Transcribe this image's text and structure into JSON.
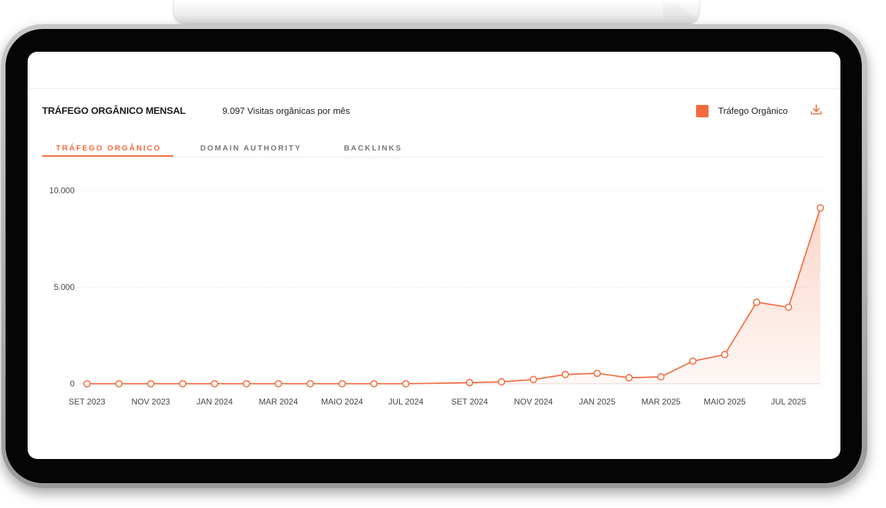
{
  "header": {
    "title": "TRÁFEGO ORGÂNICO MENSAL",
    "subtitle": "9.097 Visitas orgânicas por mês",
    "legend_label": "Tráfego Orgânico",
    "download_icon": "download-icon"
  },
  "tabs": [
    {
      "label": "TRÁFEGO ORGÂNICO",
      "active": true
    },
    {
      "label": "DOMAIN AUTHORITY",
      "active": false
    },
    {
      "label": "BACKLINKS",
      "active": false
    }
  ],
  "colors": {
    "accent": "#f26a3d",
    "grid": "#e6e6e6"
  },
  "chart_data": {
    "type": "area",
    "series": [
      {
        "name": "Tráfego Orgânico",
        "x": [
          "2023-09",
          "2023-10",
          "2023-11",
          "2023-12",
          "2024-01",
          "2024-02",
          "2024-03",
          "2024-04",
          "2024-05",
          "2024-06",
          "2024-07",
          "2024-09",
          "2024-10",
          "2024-11",
          "2024-12",
          "2025-01",
          "2025-02",
          "2025-03",
          "2025-04",
          "2025-05",
          "2025-06",
          "2025-07",
          "2025-08"
        ],
        "values": [
          0,
          0,
          0,
          0,
          0,
          0,
          0,
          0,
          0,
          0,
          0,
          60,
          100,
          220,
          480,
          540,
          310,
          360,
          1170,
          1510,
          4220,
          3960,
          9097
        ]
      }
    ],
    "x_tick_labels": [
      {
        "x": "2023-09",
        "label": "SET 2023"
      },
      {
        "x": "2023-11",
        "label": "NOV 2023"
      },
      {
        "x": "2024-01",
        "label": "JAN 2024"
      },
      {
        "x": "2024-03",
        "label": "MAR 2024"
      },
      {
        "x": "2024-05",
        "label": "MAIO 2024"
      },
      {
        "x": "2024-07",
        "label": "JUL 2024"
      },
      {
        "x": "2024-09",
        "label": "SET 2024"
      },
      {
        "x": "2024-11",
        "label": "NOV 2024"
      },
      {
        "x": "2025-01",
        "label": "JAN 2025"
      },
      {
        "x": "2025-03",
        "label": "MAR 2025"
      },
      {
        "x": "2025-05",
        "label": "MAIO 2025"
      },
      {
        "x": "2025-07",
        "label": "JUL 2025"
      }
    ],
    "y_ticks": [
      {
        "value": 0,
        "label": "0"
      },
      {
        "value": 5000,
        "label": "5.000"
      },
      {
        "value": 10000,
        "label": "10.000"
      }
    ],
    "ylim": [
      0,
      10000
    ],
    "grid": true,
    "legend_position": "top-right"
  }
}
